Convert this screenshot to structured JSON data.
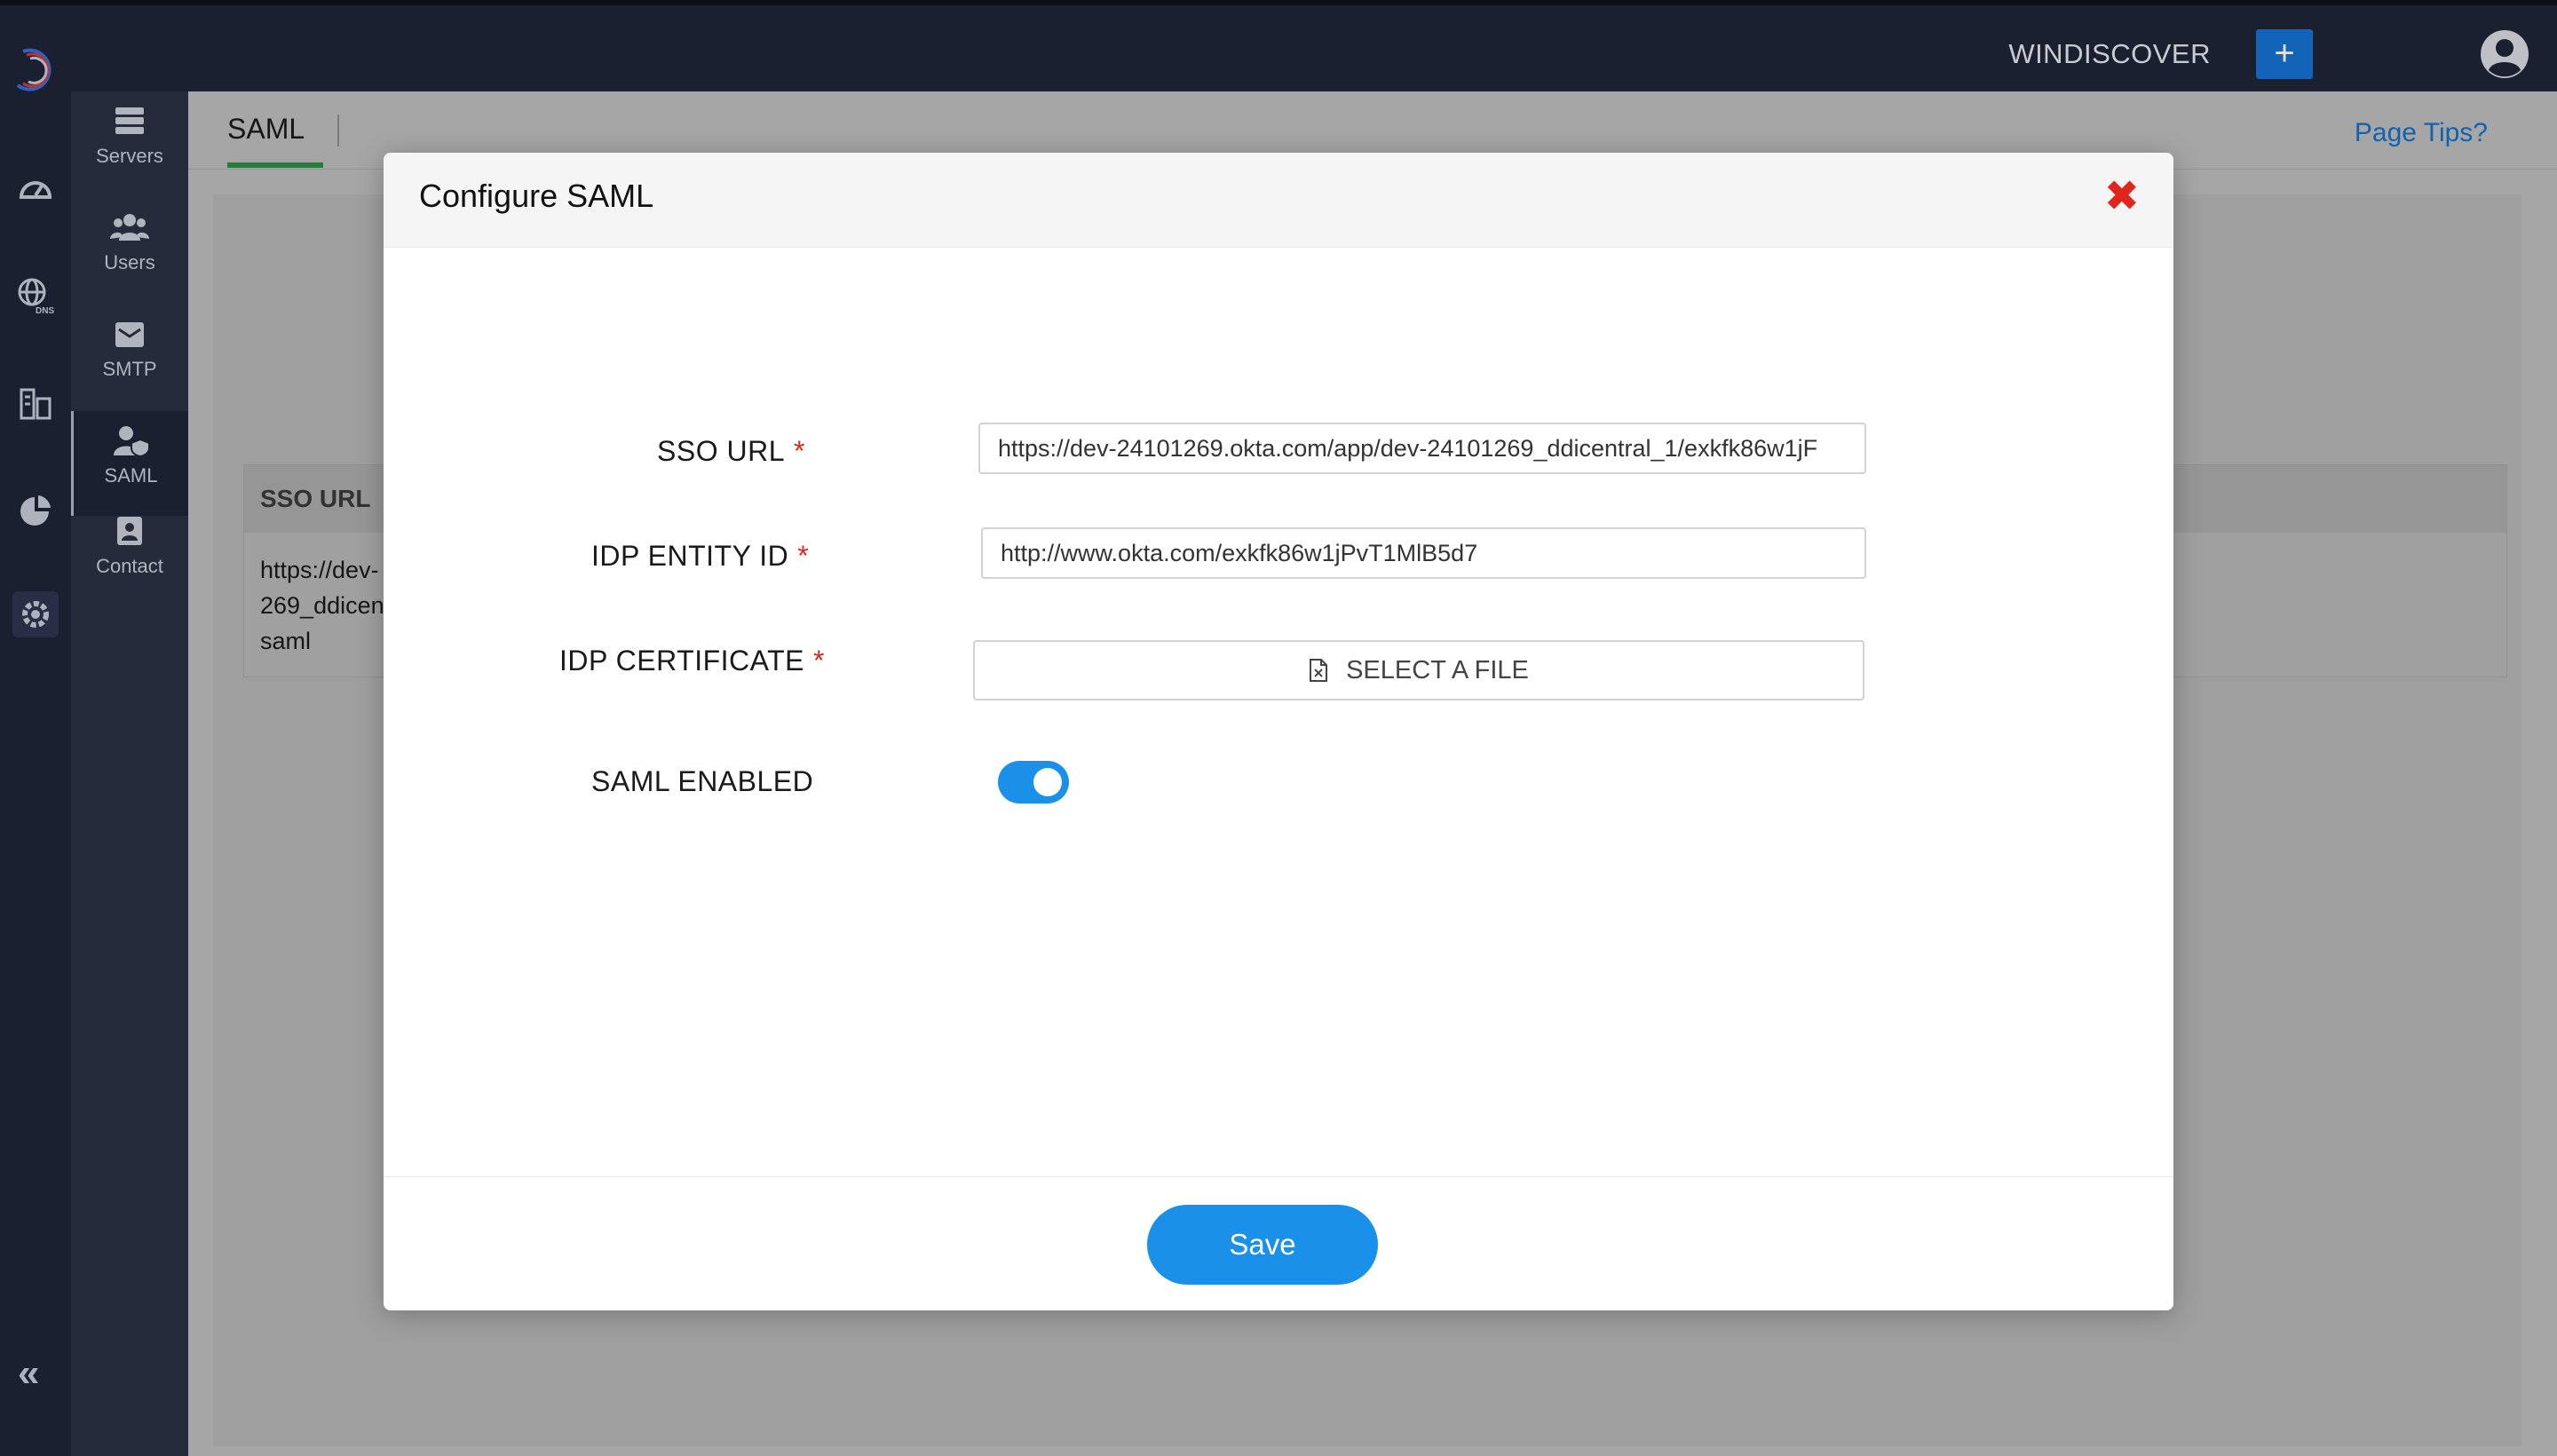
{
  "header": {
    "brand": "WINDISCOVER",
    "plus_label": "+"
  },
  "rail": {
    "icons": [
      "dashboard-icon",
      "dns-icon",
      "ipam-icon",
      "reports-icon",
      "settings-icon"
    ],
    "active": "settings-icon",
    "collapse_label": "«"
  },
  "subnav": {
    "items": [
      {
        "label": "Servers",
        "icon": "servers-icon"
      },
      {
        "label": "Users",
        "icon": "users-icon"
      },
      {
        "label": "SMTP",
        "icon": "smtp-icon"
      },
      {
        "label": "SAML",
        "icon": "saml-icon",
        "active": true
      },
      {
        "label": "Contact",
        "icon": "contact-icon"
      }
    ]
  },
  "page": {
    "tab": "SAML",
    "page_tips": "Page Tips?",
    "table": {
      "header": "SSO URL",
      "cell_lines": [
        "https://dev-",
        "269_ddicen",
        "saml"
      ]
    }
  },
  "modal": {
    "title": "Configure SAML",
    "close": "✖",
    "fields": {
      "sso_url": {
        "label": "SSO URL",
        "required": "*",
        "value": "https://dev-24101269.okta.com/app/dev-24101269_ddicentral_1/exkfk86w1jF"
      },
      "idp_entity_id": {
        "label": "IDP ENTITY ID",
        "required": "*",
        "value": "http://www.okta.com/exkfk86w1jPvT1MlB5d7"
      },
      "idp_certificate": {
        "label": "IDP CERTIFICATE",
        "required": "*",
        "button": "SELECT A FILE"
      },
      "saml_enabled": {
        "label": "SAML ENABLED",
        "on": true
      }
    },
    "save": "Save"
  },
  "colors": {
    "topbar": "#1f2538",
    "sidebar": "#2b3143",
    "accent": "#1a90e8",
    "danger": "#e2251b",
    "link": "#1570c6"
  }
}
